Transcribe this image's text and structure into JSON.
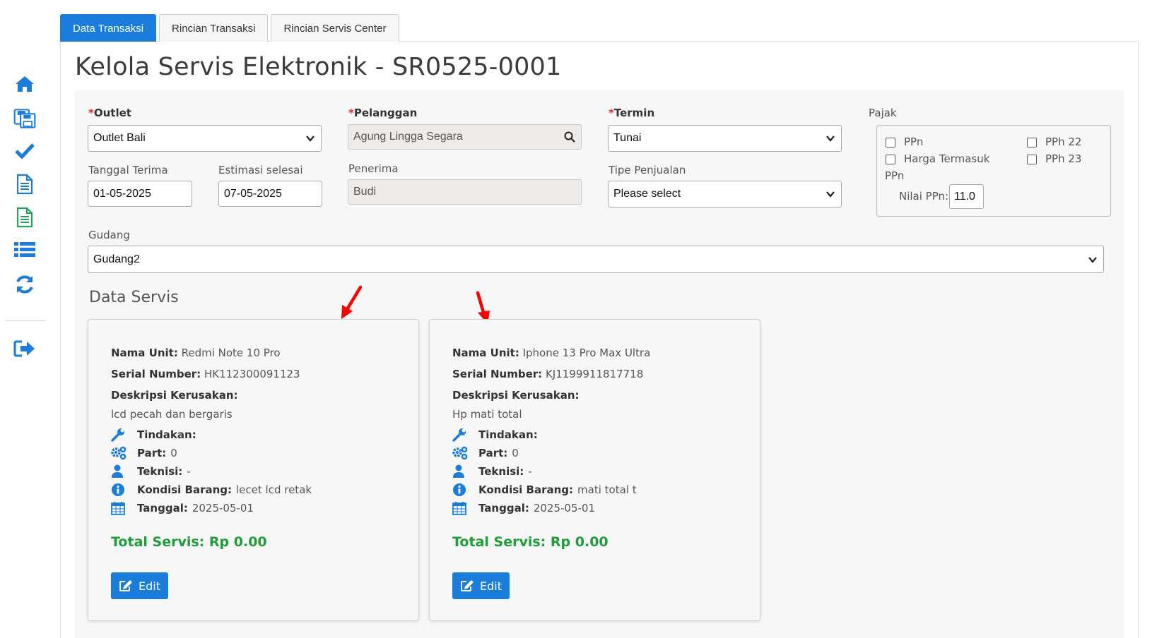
{
  "tabs": [
    {
      "label": "Data Transaksi",
      "active": true
    },
    {
      "label": "Rincian Transaksi",
      "active": false
    },
    {
      "label": "Rincian Servis Center",
      "active": false
    }
  ],
  "sidebar": {
    "icons": [
      "home-icon",
      "save-icon",
      "check-icon",
      "document-icon",
      "document-text-icon",
      "list-icon",
      "refresh-icon",
      "logout-icon"
    ]
  },
  "page_title": "Kelola Servis Elektronik - SR0525-0001",
  "form": {
    "outlet": {
      "required_mark": "*",
      "label": "Outlet",
      "value": "Outlet Bali"
    },
    "pelanggan": {
      "required_mark": "*",
      "label": "Pelanggan",
      "value": "Agung Lingga Segara"
    },
    "termin": {
      "required_mark": "*",
      "label": "Termin",
      "value": "Tunai"
    },
    "pajak": {
      "label": "Pajak",
      "ppn_label": "PPn",
      "harga_termasuk_label": "Harga Termasuk",
      "harga_termasuk_label_wrap": "PPn",
      "pph22_label": "PPh 22",
      "pph23_label": "PPh 23",
      "nilai_ppn_label": "Nilai PPn:",
      "nilai_ppn_value": "11.0"
    },
    "tanggal_terima": {
      "label": "Tanggal Terima",
      "value": "01-05-2025"
    },
    "estimasi_selesai": {
      "label": "Estimasi selesai",
      "value": "07-05-2025"
    },
    "penerima": {
      "label": "Penerima",
      "value": "Budi"
    },
    "tipe_penjualan": {
      "label": "Tipe Penjualan",
      "value": "Please select"
    },
    "gudang": {
      "label": "Gudang",
      "value": "Gudang2"
    }
  },
  "data_servis": {
    "title": "Data Servis",
    "labels": {
      "nama_unit": "Nama Unit:",
      "serial_number": "Serial Number:",
      "deskripsi": "Deskripsi Kerusakan:",
      "tindakan": "Tindakan:",
      "part": "Part:",
      "teknisi": "Teknisi:",
      "kondisi": "Kondisi Barang:",
      "tanggal": "Tanggal:",
      "total": "Total Servis:",
      "edit": "Edit"
    },
    "cards": [
      {
        "nama_unit": "Redmi Note 10 Pro",
        "serial_number": "HK112300091123",
        "deskripsi": "lcd pecah dan bergaris",
        "tindakan": "",
        "part": "0",
        "teknisi": "-",
        "kondisi": "lecet lcd retak",
        "tanggal": "2025-05-01",
        "total": "Rp 0.00"
      },
      {
        "nama_unit": "Iphone 13 Pro Max Ultra",
        "serial_number": "KJ1199911817718",
        "deskripsi": "Hp mati total",
        "tindakan": "",
        "part": "0",
        "teknisi": "-",
        "kondisi": "mati total t",
        "tanggal": "2025-05-01",
        "total": "Rp 0.00"
      }
    ]
  },
  "colors": {
    "accent": "#1a7ddb",
    "required": "#d9332a",
    "total_green": "#1f9d3a",
    "annotation_arrow": "#ff0000"
  }
}
